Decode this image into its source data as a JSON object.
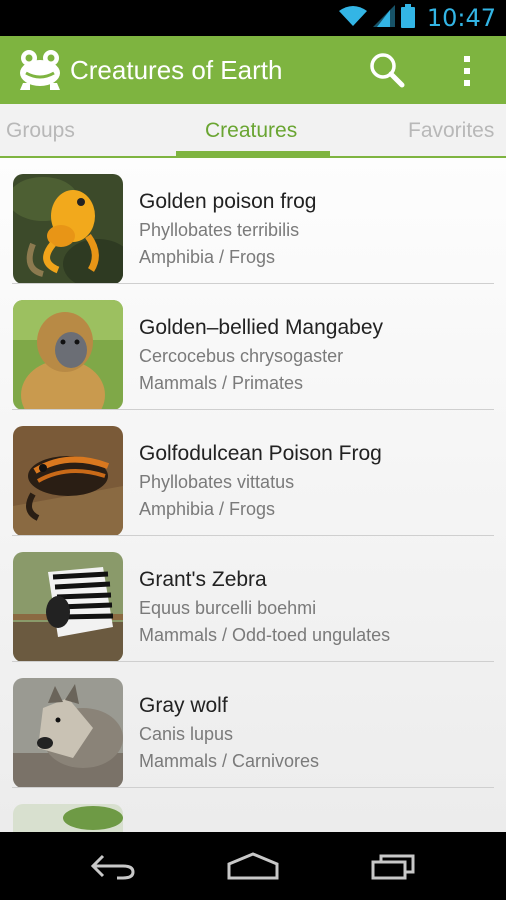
{
  "status_bar": {
    "time": "10:47",
    "icons": [
      "wifi-icon",
      "signal-icon",
      "battery-icon"
    ]
  },
  "action_bar": {
    "title": "Creatures of Earth",
    "icons": [
      "frog-logo-icon",
      "search-icon",
      "overflow-menu-icon"
    ]
  },
  "tabs": [
    {
      "label": "Groups",
      "selected": false
    },
    {
      "label": "Creatures",
      "selected": true
    },
    {
      "label": "Favorites",
      "selected": false
    }
  ],
  "creatures": [
    {
      "name": "Golden poison frog",
      "latin": "Phyllobates terribilis",
      "group": "Amphibia / Frogs"
    },
    {
      "name": "Golden–bellied Mangabey",
      "latin": "Cercocebus chrysogaster",
      "group": "Mammals / Primates"
    },
    {
      "name": "Golfodulcean Poison Frog",
      "latin": "Phyllobates vittatus",
      "group": "Amphibia / Frogs"
    },
    {
      "name": "Grant's Zebra",
      "latin": "Equus burcelli boehmi",
      "group": "Mammals / Odd-toed ungulates"
    },
    {
      "name": "Gray wolf",
      "latin": "Canis lupus",
      "group": "Mammals / Carnivores"
    }
  ],
  "colors": {
    "accent": "#7eb440",
    "tab_active": "#6aa532",
    "time": "#33b5e5"
  },
  "nav_bar": {
    "icons": [
      "back-icon",
      "home-icon",
      "recent-apps-icon"
    ]
  }
}
